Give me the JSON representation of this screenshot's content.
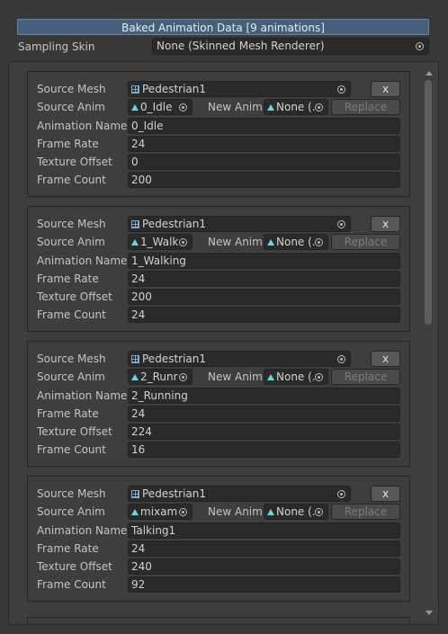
{
  "header": {
    "title": "Baked Animation Data [9 animations]"
  },
  "sampling_skin": {
    "label": "Sampling Skin",
    "value": "None (Skinned Mesh Renderer)"
  },
  "labels": {
    "source_mesh": "Source Mesh",
    "source_anim": "Source Anim",
    "new_anim": "New Anim",
    "animation_name": "Animation Name",
    "frame_rate": "Frame Rate",
    "texture_offset": "Texture Offset",
    "frame_count": "Frame Count",
    "remove_button": "x",
    "replace_button": "Replace",
    "new_anim_value": "None (."
  },
  "animations": [
    {
      "source_mesh": "Pedestrian1",
      "source_anim": "0_Idle",
      "animation_name": "0_Idle",
      "frame_rate": "24",
      "texture_offset": "0",
      "frame_count": "200"
    },
    {
      "source_mesh": "Pedestrian1",
      "source_anim": "1_Walk",
      "animation_name": "1_Walking",
      "frame_rate": "24",
      "texture_offset": "200",
      "frame_count": "24"
    },
    {
      "source_mesh": "Pedestrian1",
      "source_anim": "2_Runr",
      "animation_name": "2_Running",
      "frame_rate": "24",
      "texture_offset": "224",
      "frame_count": "16"
    },
    {
      "source_mesh": "Pedestrian1",
      "source_anim": "mixam",
      "animation_name": "Talking1",
      "frame_rate": "24",
      "texture_offset": "240",
      "frame_count": "92"
    }
  ],
  "icons": {
    "mesh": "mesh-grid-icon",
    "anim": "animation-clip-icon",
    "picker": "object-picker-icon"
  },
  "colors": {
    "header_bg": "#46607c",
    "anim_icon": "#6cd4e0",
    "panel_bg": "#3e3e3e",
    "field_bg": "#2a2a2a"
  }
}
